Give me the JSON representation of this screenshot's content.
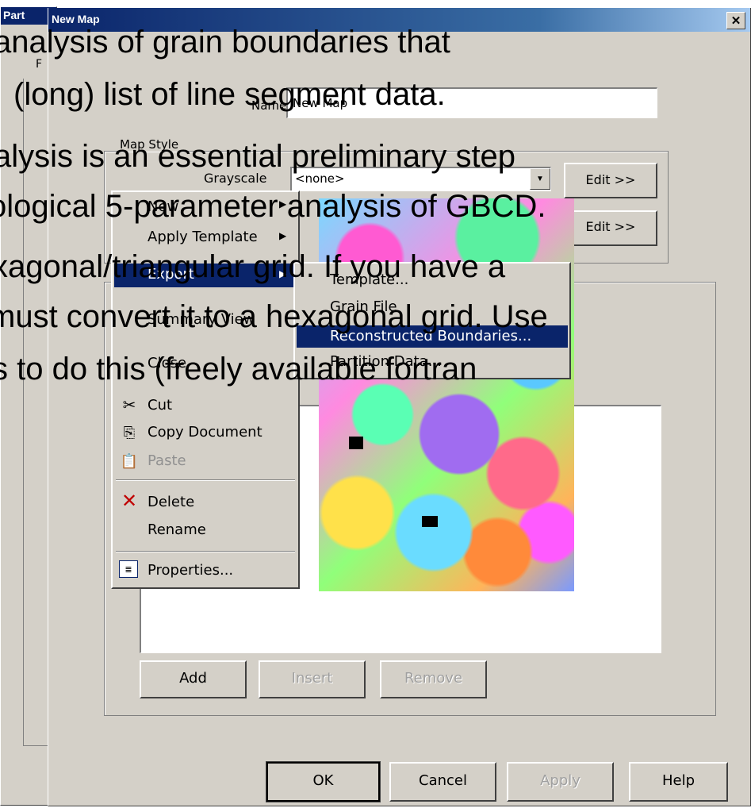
{
  "back_dialog": {
    "title": "Part",
    "field_prefix": "F"
  },
  "dialog": {
    "title": "New Map",
    "name_label": "Name",
    "name_value": "New Map",
    "map_style_label": "Map Style",
    "grayscale_label": "Grayscale",
    "grayscale_value": "<none>",
    "edit_button_1": "Edit >>",
    "edit_button_2": "Edit >>",
    "add_button": "Add",
    "insert_button": "Insert",
    "remove_button": "Remove",
    "ok_button": "OK",
    "cancel_button": "Cancel",
    "apply_button": "Apply",
    "help_button": "Help"
  },
  "context_menu": {
    "items": [
      {
        "label": "New",
        "submenu": true
      },
      {
        "label": "Apply Template",
        "submenu": true
      },
      {
        "label": "Export",
        "submenu": true,
        "highlighted": true
      },
      {
        "label": "Summary View"
      },
      {
        "label": "Close"
      },
      {
        "label": "Cut",
        "icon": "scissors-icon"
      },
      {
        "label": "Copy Document",
        "icon": "copy-icon"
      },
      {
        "label": "Paste",
        "icon": "paste-icon",
        "disabled": true
      },
      {
        "label": "Delete",
        "icon": "delete-x-icon"
      },
      {
        "label": "Rename"
      },
      {
        "label": "Properties...",
        "icon": "properties-icon"
      }
    ]
  },
  "export_submenu": {
    "items": [
      {
        "label": "Template..."
      },
      {
        "label": "Grain File"
      },
      {
        "label": "Reconstructed Boundaries...",
        "highlighted": true
      },
      {
        "label": "Partition Data..."
      }
    ]
  },
  "slide_text": {
    "line1": "analysis of grain boundaries that",
    "line2": "(long) list of line segment data.",
    "line3": "alysis is an essential preliminary step",
    "line4": "ological 5-parameter analysis of GBCD.",
    "line5": "xagonal/triangular grid.  If you have a",
    "line6": "must convert it to a hexagonal grid.  Use",
    "line7": "s to do this (freely available fortran"
  },
  "colors": {
    "title_bar": "#0a246a",
    "menu_highlight": "#0a246a",
    "dialog_bg": "#d4d0c8"
  }
}
